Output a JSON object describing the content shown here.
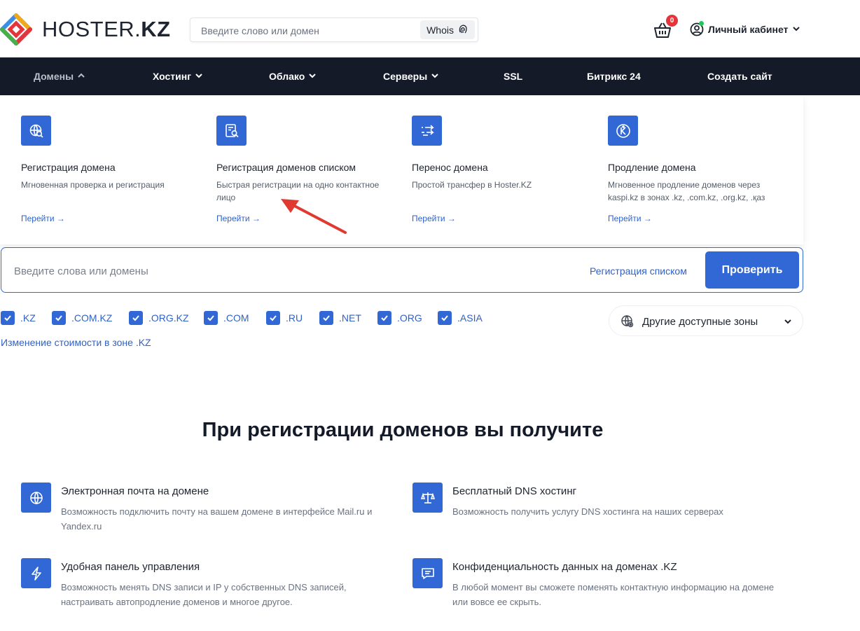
{
  "header": {
    "logo_text_plain": "HOSTER.",
    "logo_text_bold": "KZ",
    "search_placeholder": "Введите слово или домен",
    "whois_label": "Whois",
    "cart_count": "0",
    "account_label": "Личный кабинет"
  },
  "nav": {
    "items": [
      {
        "label": "Домены",
        "active": true
      },
      {
        "label": "Хостинг"
      },
      {
        "label": "Облако"
      },
      {
        "label": "Серверы"
      },
      {
        "label": "SSL"
      },
      {
        "label": "Битрикс 24"
      },
      {
        "label": "Создать сайт"
      }
    ]
  },
  "dropdown": {
    "cards": [
      {
        "title": "Регистрация домена",
        "desc": "Мгновенная проверка и регистрация",
        "link": "Перейти →",
        "icon": "globe-search-icon"
      },
      {
        "title": "Регистрация доменов списком",
        "desc": "Быстрая регистрации на одно контактное лицо",
        "link": "Перейти →",
        "icon": "list-search-icon"
      },
      {
        "title": "Перенос домена",
        "desc": "Простой трансфер в Hoster.KZ",
        "link": "Перейти →",
        "icon": "transfer-icon"
      },
      {
        "title": "Продление домена",
        "desc": "Мгновенное продление доменов через kaspi.kz в зонах .kz, .com.kz, .org.kz, .қаз",
        "link": "Перейти →",
        "icon": "kaspi-icon"
      }
    ]
  },
  "domain_search": {
    "placeholder": "Введите слова или домены",
    "list_link": "Регистрация списком",
    "check_button": "Проверить",
    "zones": [
      ".KZ",
      ".COM.KZ",
      ".ORG.KZ",
      ".COM",
      ".RU",
      ".NET",
      ".ORG",
      ".ASIA"
    ],
    "other_zones_label": "Другие доступные зоны",
    "price_change_link": "Изменение стоимости в зоне .KZ"
  },
  "benefits": {
    "title": "При регистрации доменов вы получите",
    "items": [
      {
        "title": "Электронная почта на домене",
        "desc": "Возможность подключить почту на вашем домене в интерфейсе Mail.ru и Yandex.ru",
        "icon": "globe-icon"
      },
      {
        "title": "Бесплатный DNS хостинг",
        "desc": "Возможность получить услугу DNS хостинга на наших серверах",
        "icon": "scales-icon"
      },
      {
        "title": "Удобная панель управления",
        "desc": "Возможность менять DNS записи и IP у собственных DNS записей, настраивать автопродление доменов и многое другое.",
        "icon": "lightning-icon"
      },
      {
        "title": "Конфиденциальность данных на доменах .KZ",
        "desc": "В любой момент вы сможете поменять контактную информацию на домене или вовсе ее скрыть.",
        "icon": "message-icon"
      }
    ]
  },
  "colors": {
    "accent": "#3268d6",
    "nav_bg": "#141a28",
    "badge": "#e5343a",
    "annotation_arrow": "#e0392f"
  }
}
